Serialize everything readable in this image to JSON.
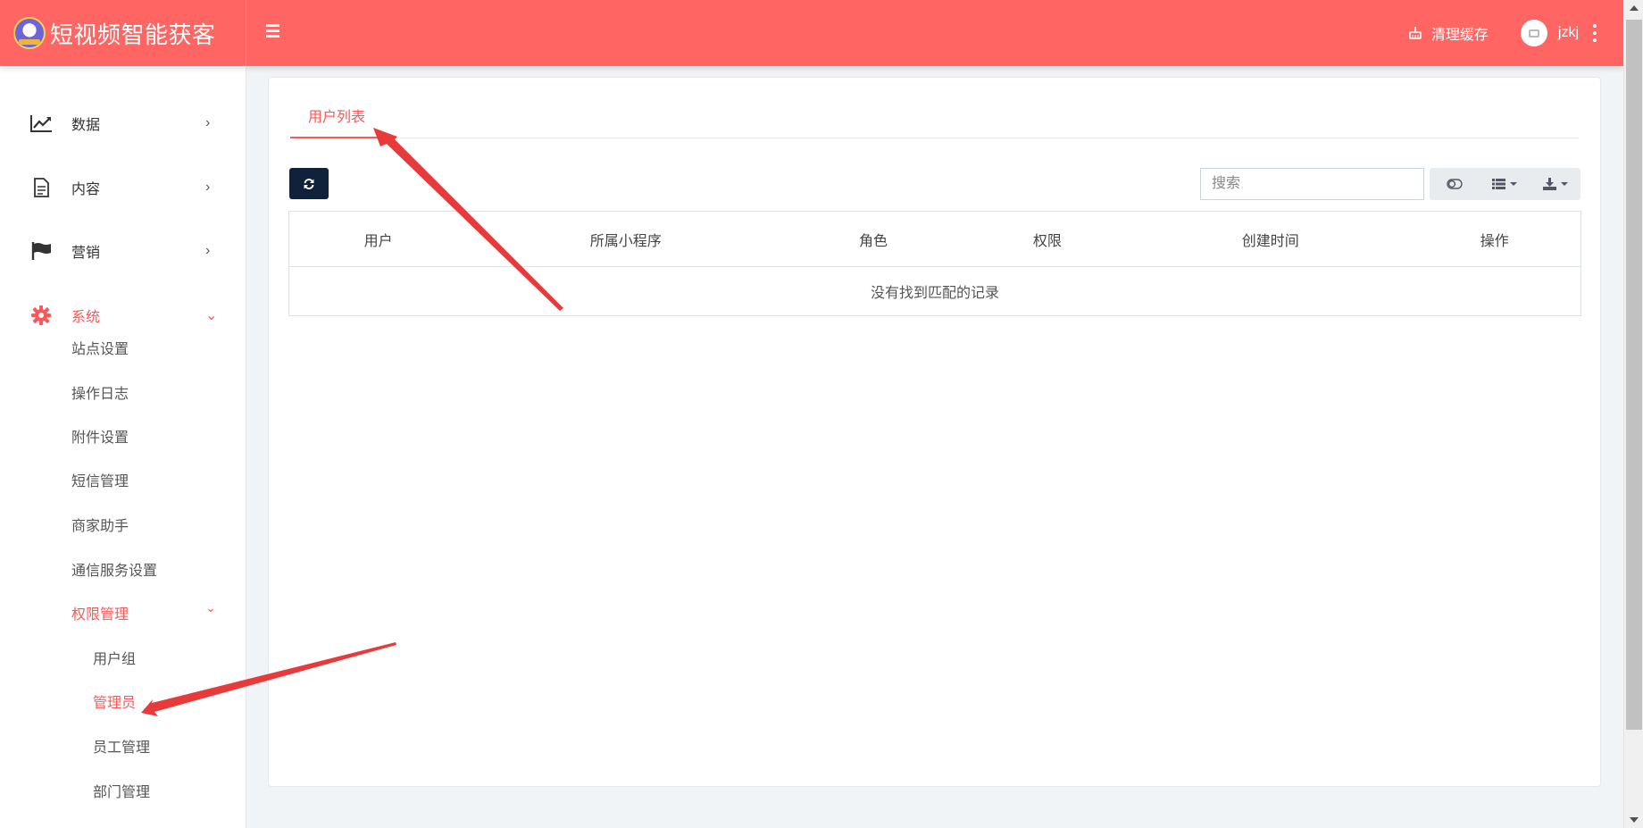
{
  "brand": {
    "title": "短视频智能获客"
  },
  "header": {
    "clear_cache": "清理缓存",
    "username": "jzkj"
  },
  "sidebar": {
    "items": [
      {
        "label": "数据",
        "icon": "line-chart-icon"
      },
      {
        "label": "内容",
        "icon": "document-icon"
      },
      {
        "label": "营销",
        "icon": "flag-icon"
      },
      {
        "label": "系统",
        "icon": "gear-icon"
      }
    ],
    "system_children": [
      "站点设置",
      "操作日志",
      "附件设置",
      "短信管理",
      "商家助手",
      "通信服务设置",
      "权限管理"
    ],
    "permission_children": [
      "用户组",
      "管理员",
      "员工管理",
      "部门管理"
    ]
  },
  "main": {
    "tab": "用户列表",
    "search_placeholder": "搜索",
    "table": {
      "columns": [
        "用户",
        "所属小程序",
        "角色",
        "权限",
        "创建时间",
        "操作"
      ],
      "empty_text": "没有找到匹配的记录"
    }
  },
  "colors": {
    "header": "#ff6562",
    "accent": "#ff5757",
    "refresh_button": "#10213a",
    "annotation_arrow": "#e83a3a"
  }
}
